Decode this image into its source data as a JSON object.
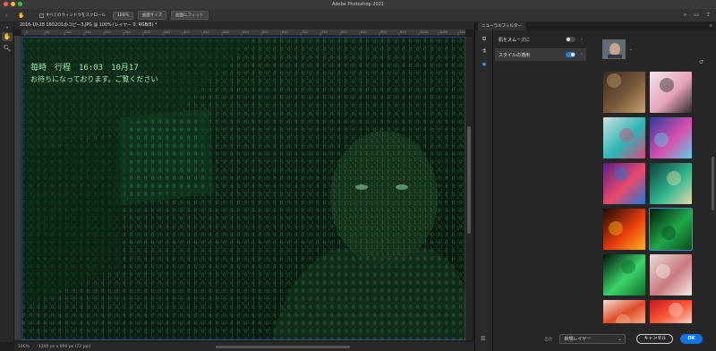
{
  "window": {
    "title": "Adobe Photoshop 2021",
    "traffic_colors": [
      "#ff5f57",
      "#febc2e",
      "#28c840"
    ]
  },
  "options_bar": {
    "scroll_all_label": "すべてのウィンドウをスクロール",
    "zoom_label": "100%",
    "fit_screen_label": "画面サイズ",
    "fill_screen_label": "画面にフィット"
  },
  "document": {
    "tab_title": "2016-10-28 16O2O1のコピー3.JPG @ 100% (レイヤー 0, RGB/8) *",
    "ruler_ticks": [
      "0",
      "50",
      "100",
      "150",
      "200",
      "250",
      "300",
      "350",
      "400",
      "450",
      "500",
      "550",
      "600",
      "650",
      "700",
      "750",
      "800",
      "850",
      "900",
      "950",
      "1000",
      "1050",
      "1100"
    ],
    "matrix_text_line1": "毎時　行程　16:03　10月17",
    "matrix_text_line2": "お待ちになっております。ご覧ください"
  },
  "status_bar": {
    "zoom": "100%",
    "doc_size": "1200 px x 800 px (72 ppi)"
  },
  "panel": {
    "tab_label": "ニューラルフィルター",
    "filters": [
      {
        "label": "肌をスムーズに",
        "enabled": false
      },
      {
        "label": "スタイルの適用",
        "enabled": true
      }
    ],
    "style_thumbnails": [
      {
        "name": "dark-room",
        "colors": [
          "#3a2a1e",
          "#7a5a3a",
          "#c9a070"
        ]
      },
      {
        "name": "pink-face",
        "colors": [
          "#f3e6ea",
          "#e6a3b9",
          "#2b2b2b"
        ]
      },
      {
        "name": "mask-face",
        "colors": [
          "#cfe0e0",
          "#2cb5b5",
          "#e0457b"
        ]
      },
      {
        "name": "fluid-paint",
        "colors": [
          "#2d3a9e",
          "#d94fb0",
          "#5ad0e6"
        ]
      },
      {
        "name": "eye-art",
        "colors": [
          "#5a1e8a",
          "#e84a6a",
          "#1e7ad8"
        ]
      },
      {
        "name": "teal-swirl",
        "colors": [
          "#0e3e3a",
          "#2fb58e",
          "#e6d9a8"
        ]
      },
      {
        "name": "lava-cracks",
        "colors": [
          "#1a0a04",
          "#e63a0a",
          "#ffb21e"
        ]
      },
      {
        "name": "matrix-code",
        "colors": [
          "#001a08",
          "#1fa84a",
          "#0a4a1c"
        ]
      },
      {
        "name": "green-code",
        "colors": [
          "#001405",
          "#3cd36a",
          "#0e6e2a"
        ]
      },
      {
        "name": "marble-pink",
        "colors": [
          "#e8dcd6",
          "#c97a80",
          "#f4ede8"
        ]
      },
      {
        "name": "red-abstract",
        "colors": [
          "#f0e0d0",
          "#e04a2a",
          "#f7b08a"
        ]
      },
      {
        "name": "crimson",
        "colors": [
          "#c8141e",
          "#ff5a3a",
          "#f2d2c8"
        ]
      }
    ],
    "output_label": "出力",
    "output_value": "新規レイヤー",
    "cancel_label": "キャンセル",
    "ok_label": "OK"
  }
}
